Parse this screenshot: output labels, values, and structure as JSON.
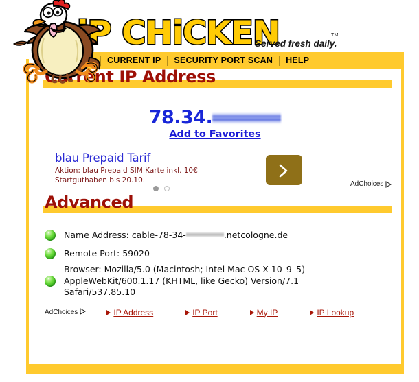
{
  "site": {
    "logo_text": "iP CHiCKEN",
    "tagline": "Served fresh daily.",
    "trademark": "TM"
  },
  "nav": {
    "items": [
      {
        "label": "CURRENT IP"
      },
      {
        "label": "SECURITY PORT SCAN"
      },
      {
        "label": "HELP"
      }
    ]
  },
  "current_ip_section": {
    "title": "Current IP Address",
    "ip_visible_prefix": "78.34.",
    "ip_redacted": true,
    "add_to_favorites_label": "Add to Favorites"
  },
  "ad": {
    "title": "blau Prepaid Tarif",
    "description": "Aktion: blau Prepaid SIM Karte inkl. 10€ Startguthaben bis 20.10.",
    "cta_icon": "chevron-right-icon",
    "carousel": {
      "total": 2,
      "active_index": 0
    },
    "adchoices_label": "AdChoices"
  },
  "advanced_section": {
    "title": "Advanced",
    "items": [
      {
        "icon": "green-status-dot",
        "label": "Name Address:",
        "value_prefix": "cable-78-34-",
        "value_redacted": true,
        "value_suffix": ".netcologne.de"
      },
      {
        "icon": "green-status-dot",
        "label": "Remote Port:",
        "value": "59020"
      },
      {
        "icon": "green-status-dot",
        "label": "Browser:",
        "value": "Mozilla/5.0 (Macintosh; Intel Mac OS X 10_9_5) AppleWebKit/600.1.17 (KHTML, like Gecko) Version/7.1 Safari/537.85.10"
      }
    ]
  },
  "bottom_links": {
    "adchoices_label": "AdChoices",
    "links": [
      {
        "label": "IP Address"
      },
      {
        "label": "IP Port"
      },
      {
        "label": "My IP"
      },
      {
        "label": "IP Lookup"
      }
    ]
  },
  "colors": {
    "brand_yellow": "#ffca2e",
    "heading_red": "#9d1007",
    "ip_blue": "#1826d8",
    "link_red": "#a81608",
    "ad_title_blue": "#2b2bd4",
    "ad_desc_red": "#7a1414",
    "cta_brown": "#8f7018",
    "status_green": "#3fbf22"
  }
}
